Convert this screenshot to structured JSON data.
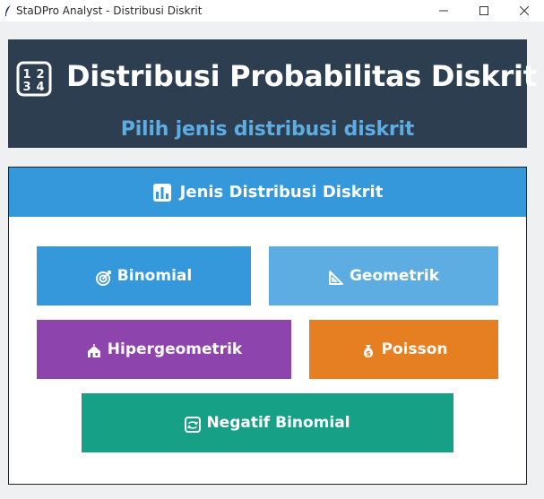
{
  "window": {
    "title": "StaDPro Analyst - Distribusi Diskrit",
    "app_icon": "feather-icon",
    "minimize_glyph": "—",
    "maximize_glyph": "☐",
    "close_glyph": "✕"
  },
  "header": {
    "icon": "numbers-1234-icon",
    "title": "Distribusi Probabilitas Diskrit",
    "subtitle": "Pilih jenis distribusi diskrit"
  },
  "panel": {
    "icon": "bar-chart-icon",
    "title": "Jenis Distribusi Diskrit"
  },
  "buttons": [
    {
      "label": "Binomial",
      "icon": "target-icon",
      "color": "#3498db"
    },
    {
      "label": "Geometrik",
      "icon": "triangle-ruler-icon",
      "color": "#5dade2"
    },
    {
      "label": "Hipergeometrik",
      "icon": "houses-icon",
      "color": "#8e44ad"
    },
    {
      "label": "Poisson",
      "icon": "money-bag-icon",
      "color": "#e67e22"
    },
    {
      "label": "Negatif Binomial",
      "icon": "repeat-icon",
      "color": "#16a085"
    }
  ],
  "colors": {
    "header_bg": "#2c3e50",
    "subtitle": "#5dade2",
    "panel_head_bg": "#3498db",
    "window_bg": "#eef0f1"
  }
}
